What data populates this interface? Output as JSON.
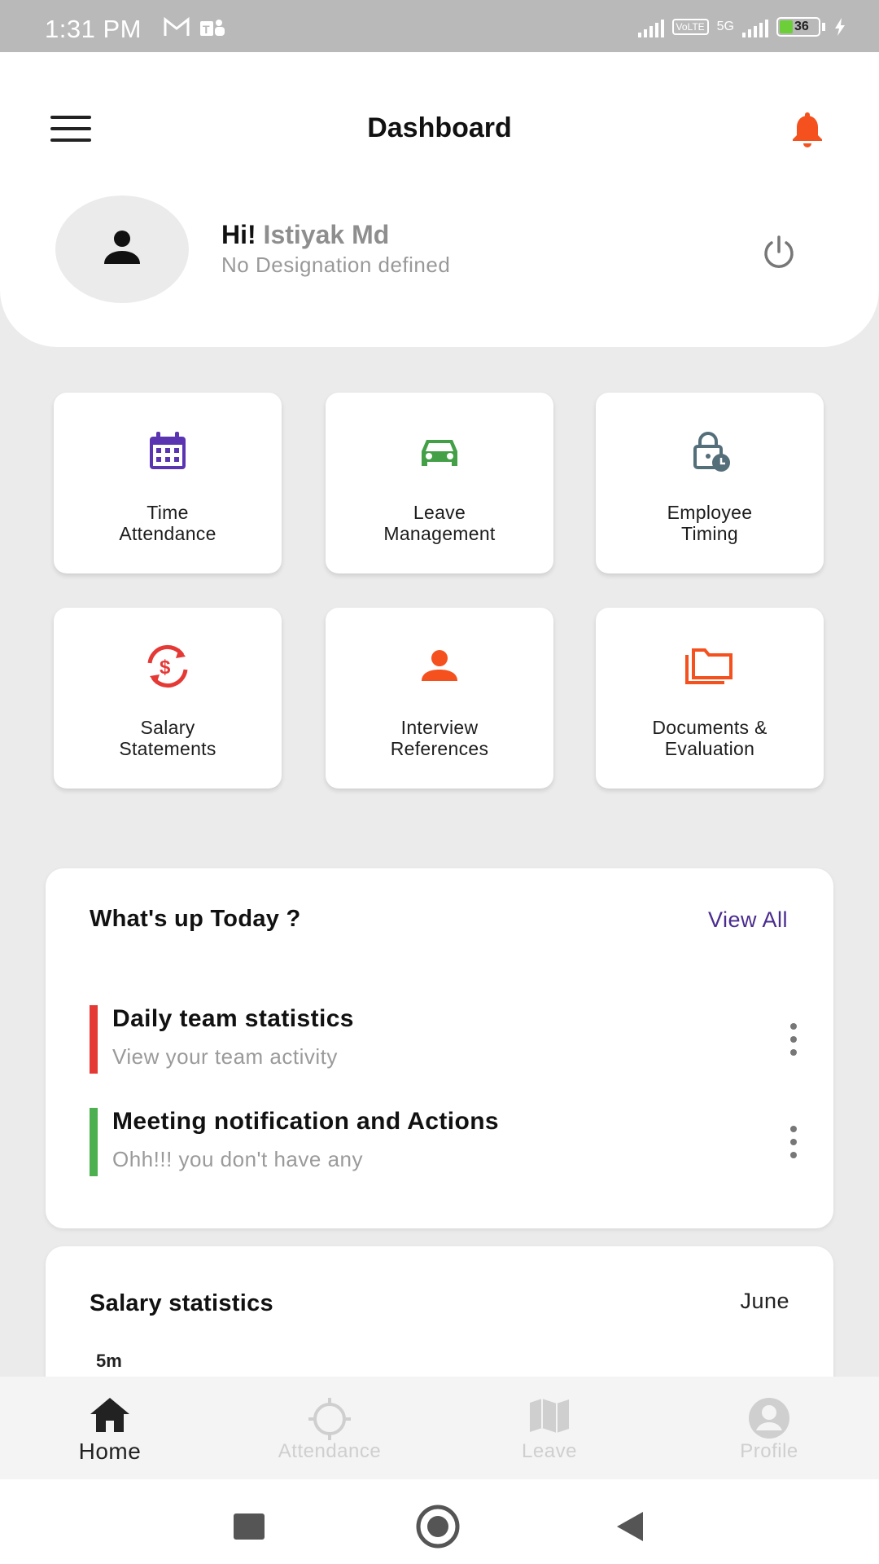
{
  "status_bar": {
    "time": "1:31 PM",
    "network_badge": "VoLTE",
    "network_type": "5G",
    "battery": "36"
  },
  "header": {
    "title": "Dashboard"
  },
  "profile": {
    "greeting": "Hi!",
    "name": "Istiyak Md",
    "designation": "No Designation defined"
  },
  "tiles": [
    {
      "label": "Time\nAttendance",
      "icon": "calendar-icon",
      "color": "#5b35b1"
    },
    {
      "label": "Leave\nManagement",
      "icon": "car-icon",
      "color": "#43a047"
    },
    {
      "label": "Employee\nTiming",
      "icon": "lock-clock-icon",
      "color": "#546e7a"
    },
    {
      "label": "Salary\nStatements",
      "icon": "currency-exchange-icon",
      "color": "#e53935"
    },
    {
      "label": "Interview\nReferences",
      "icon": "person-icon",
      "color": "#f4511e"
    },
    {
      "label": "Documents &\nEvaluation",
      "icon": "folders-icon",
      "color": "#f4511e"
    }
  ],
  "whats_up": {
    "title": "What's up Today ?",
    "view_all": "View All",
    "items": [
      {
        "title": "Daily team statistics",
        "subtitle": "View your team activity",
        "color": "#e53935"
      },
      {
        "title": "Meeting notification and Actions",
        "subtitle": "Ohh!!! you don't have any",
        "color": "#4caf50"
      }
    ]
  },
  "salary_stats": {
    "title": "Salary statistics",
    "month": "June",
    "y_top": "5m"
  },
  "bottom_nav": [
    {
      "label": "Home",
      "icon": "home-icon",
      "active": true
    },
    {
      "label": "Attendance",
      "icon": "crosshair-icon",
      "active": false
    },
    {
      "label": "Leave",
      "icon": "map-icon",
      "active": false
    },
    {
      "label": "Profile",
      "icon": "account-circle-icon",
      "active": false
    }
  ],
  "colors": {
    "accent": "#4a2c8f",
    "bell": "#f4511e",
    "background": "#ebebeb"
  }
}
